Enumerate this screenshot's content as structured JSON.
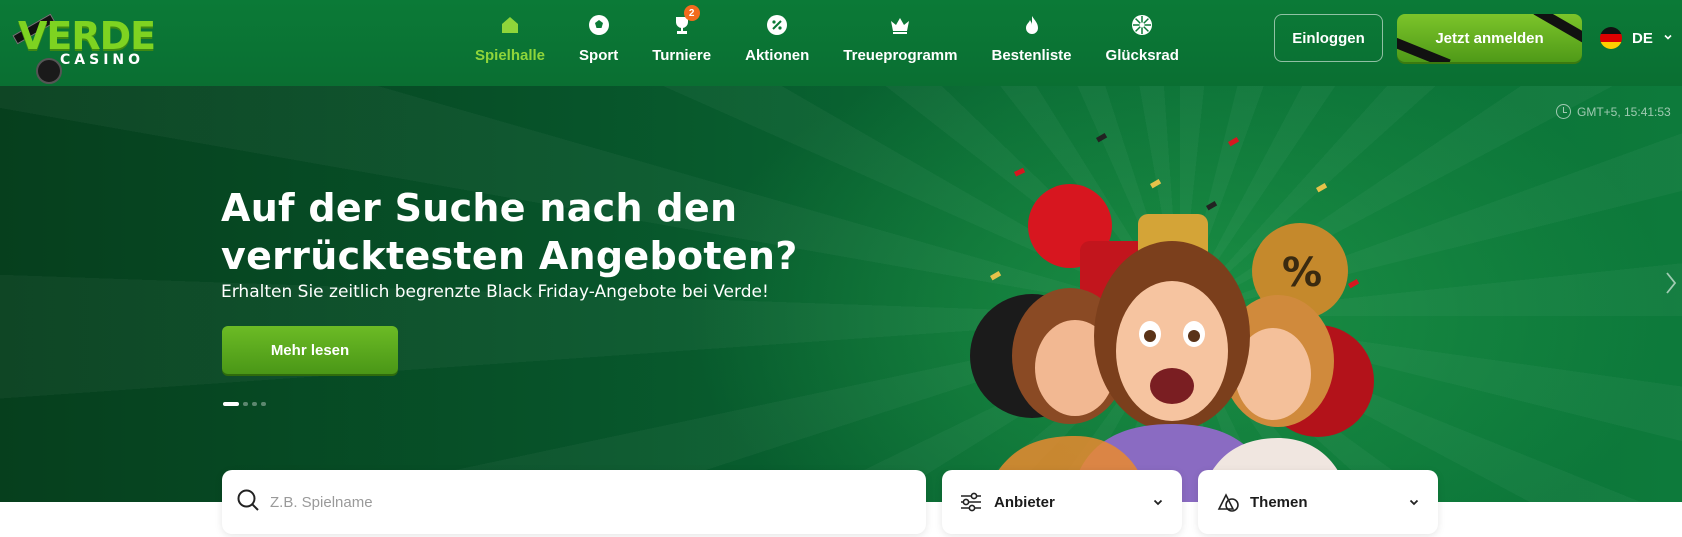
{
  "logo": {
    "main": "VERDE",
    "sub": "CASINO"
  },
  "nav": {
    "items": [
      {
        "label": "Spielhalle",
        "icon": "home-icon",
        "active": true
      },
      {
        "label": "Sport",
        "icon": "soccer-ball-icon"
      },
      {
        "label": "Turniere",
        "icon": "trophy-icon",
        "badge": "2"
      },
      {
        "label": "Aktionen",
        "icon": "percent-badge-icon"
      },
      {
        "label": "Treueprogramm",
        "icon": "crown-icon"
      },
      {
        "label": "Bestenliste",
        "icon": "flame-icon"
      },
      {
        "label": "Glücksrad",
        "icon": "wheel-icon"
      }
    ]
  },
  "header": {
    "login_label": "Einloggen",
    "register_label": "Jetzt anmelden",
    "language": "DE"
  },
  "hero": {
    "clock": "GMT+5, 15:41:53",
    "title_line1": "Auf der Suche nach den",
    "title_line2": "verrücktesten Angeboten?",
    "subtitle": "Erhalten Sie zeitlich begrenzte Black Friday-Angebote bei Verde!",
    "cta": "Mehr lesen",
    "slide_count": 4,
    "active_slide": 1
  },
  "search": {
    "placeholder": "Z.B. Spielname"
  },
  "filters": {
    "provider_label": "Anbieter",
    "themes_label": "Themen"
  },
  "colors": {
    "header_bg": "#0b7a37",
    "accent_green": "#7cc42a",
    "active_nav": "#8fd53a",
    "badge_orange": "#f26b1d"
  }
}
